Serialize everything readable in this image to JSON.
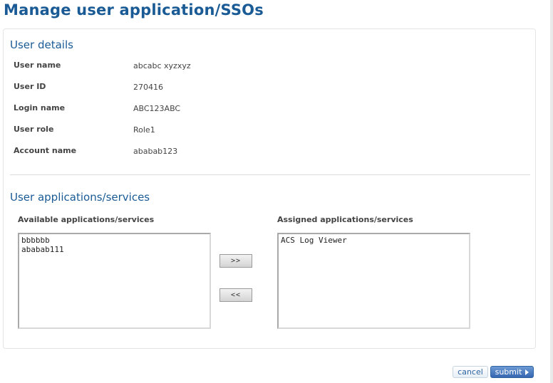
{
  "page": {
    "title": "Manage user application/SSOs"
  },
  "user_details": {
    "title": "User details",
    "fields": [
      {
        "label": "User name",
        "value": "abcabc xyzxyz"
      },
      {
        "label": "User ID",
        "value": "270416"
      },
      {
        "label": "Login name",
        "value": "ABC123ABC"
      },
      {
        "label": "User role",
        "value": "Role1"
      },
      {
        "label": "Account name",
        "value": "ababab123"
      }
    ]
  },
  "applications": {
    "title": "User applications/services",
    "available_label": "Available applications/services",
    "available": [
      "bbbbbb",
      "ababab111"
    ],
    "assigned_label": "Assigned applications/services",
    "assigned": [
      "ACS Log Viewer"
    ],
    "add_label": ">>",
    "remove_label": "<<"
  },
  "actions": {
    "cancel_label": "cancel",
    "submit_label": "submit"
  }
}
